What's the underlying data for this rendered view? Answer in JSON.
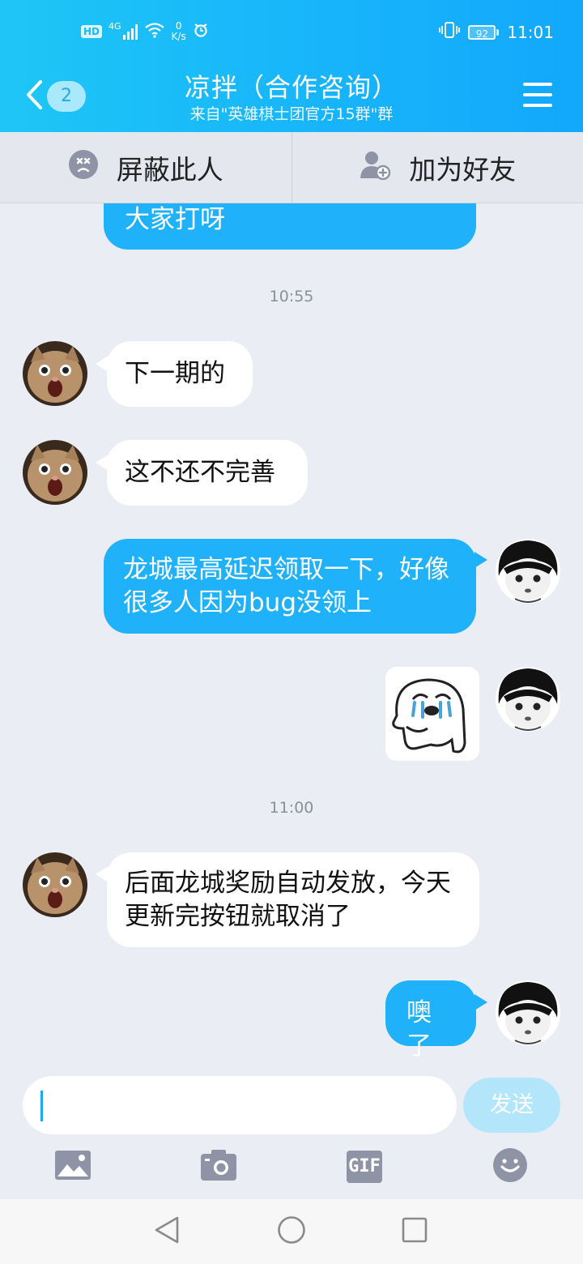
{
  "status_bar": {
    "hd": "HD",
    "network": "4G",
    "speed_value": "0",
    "speed_unit": "K/s",
    "battery": "92",
    "time": "11:01"
  },
  "header": {
    "unread_count": "2",
    "title": "凉拌（合作咨询）",
    "subtitle": "来自\"英雄棋士团官方15群\"群"
  },
  "actions": {
    "block": "屏蔽此人",
    "add_friend": "加为好友"
  },
  "messages": {
    "m0_text": "大家打呀",
    "ts1": "10:55",
    "m1_text": "下一期的",
    "m2_text": "这不还不完善",
    "m3_text": "龙城最高延迟领取一下，好像很多人因为bug没领上",
    "ts2": "11:00",
    "m5_text": "后面龙城奖励自动发放，今天更新完按钮就取消了",
    "m6_text": "噢了"
  },
  "input": {
    "placeholder": "",
    "send_label": "发送",
    "gif_label": "GIF"
  },
  "colors": {
    "header_gradient_start": "#1ec6f6",
    "header_gradient_end": "#12a8fb",
    "outgoing_bubble": "#1fb1fa",
    "incoming_bubble": "#ffffff",
    "background": "#eaedf4",
    "toolbar_icon": "#8e94a6"
  }
}
